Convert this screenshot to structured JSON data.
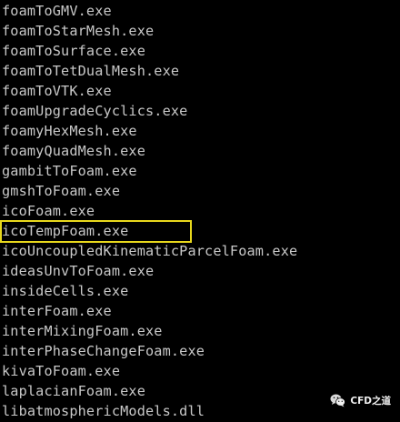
{
  "terminal": {
    "lines": [
      "foamToGMV.exe",
      "foamToStarMesh.exe",
      "foamToSurface.exe",
      "foamToTetDualMesh.exe",
      "foamToVTK.exe",
      "foamUpgradeCyclics.exe",
      "foamyHexMesh.exe",
      "foamyQuadMesh.exe",
      "gambitToFoam.exe",
      "gmshToFoam.exe",
      "icoFoam.exe",
      "icoTempFoam.exe",
      "icoUncoupledKinematicParcelFoam.exe",
      "ideasUnvToFoam.exe",
      "insideCells.exe",
      "interFoam.exe",
      "interMixingFoam.exe",
      "interPhaseChangeFoam.exe",
      "kivaToFoam.exe",
      "laplacianFoam.exe",
      "libatmosphericModels.dll"
    ],
    "highlighted_line": "icoTempFoam.exe"
  },
  "watermark": {
    "icon": "wechat-icon",
    "label": "CFD之道"
  },
  "colors": {
    "background": "#000000",
    "text": "#c8c8c8",
    "highlight_border": "#e8d81c"
  }
}
